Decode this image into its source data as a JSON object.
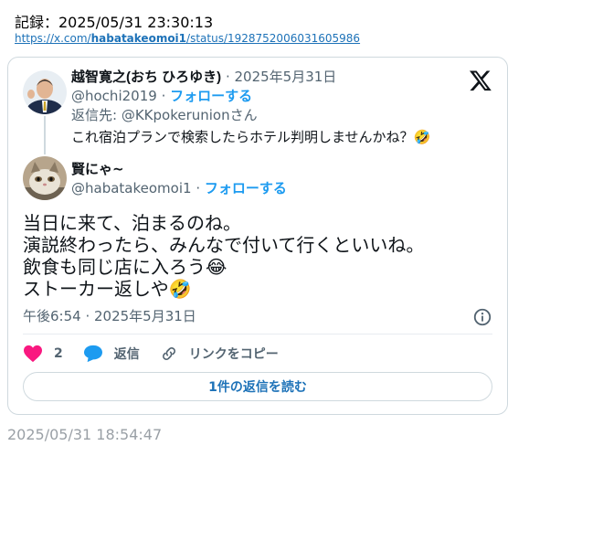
{
  "header": {
    "record": "記録：2025/05/31 23:30:13",
    "url_prefix": "https://x.com/",
    "url_user": "habatakeomoi1",
    "url_suffix": "/status/1928752006031605986"
  },
  "parent_tweet": {
    "display_name": "越智寛之(おち ひろゆき)",
    "date": "· 2025年5月31日",
    "handle": "@hochi2019",
    "follow": "フォローする",
    "reply_to": "返信先: @KKpokerunionさん",
    "text": "これ宿泊プランで検索したらホテル判明しませんかね？🤣"
  },
  "tweet": {
    "display_name": "賢にゃ~",
    "handle": "@habatakeomoi1",
    "follow": "フォローする",
    "body": "当日に来て、泊まるのね。\n演説終わったら、みんなで付いて行くといいね。\n飲食も同じ店に入ろう😂\nストーカー返しや🤣",
    "timestamp": "午後6:54 · 2025年5月31日",
    "like_count": "2",
    "reply_label": "返信",
    "copy_link_label": "リンクをコピー",
    "read_replies": "1件の返信を読む"
  },
  "footer": {
    "saved_time": "2025/05/31 18:54:47"
  },
  "colors": {
    "link_blue": "#1d9bf0",
    "like_pink": "#f91880",
    "muted": "#536471"
  }
}
